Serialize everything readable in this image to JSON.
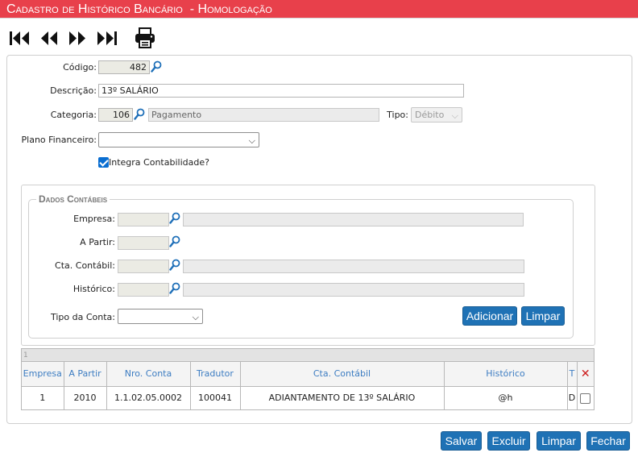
{
  "title": "Cadastro de Histórico Bancário  - Homologação",
  "toolbar": {
    "icons": [
      "first-record-icon",
      "previous-record-icon",
      "next-record-icon",
      "last-record-icon",
      "print-icon"
    ]
  },
  "form": {
    "codigo_label": "Código:",
    "codigo_value": "482",
    "descricao_label": "Descrição:",
    "descricao_value": "13º SALÁRIO",
    "categoria_label": "Categoria:",
    "categoria_code": "106",
    "categoria_name": "Pagamento",
    "tipo_label": "Tipo:",
    "tipo_value": "Débito",
    "plano_label": "Plano Financeiro:",
    "plano_value": "",
    "integra_label": "Integra Contabilidade?",
    "integra_checked": true
  },
  "dados": {
    "legend": "Dados Contábeis",
    "empresa_label": "Empresa:",
    "empresa_value": "",
    "empresa_desc": "",
    "apartir_label": "A Partir:",
    "apartir_value": "",
    "cta_label": "Cta. Contábil:",
    "cta_value": "",
    "cta_desc": "",
    "historico_label": "Histórico:",
    "historico_value": "",
    "historico_desc": "",
    "tipo_conta_label": "Tipo da Conta:",
    "tipo_conta_value": "",
    "adicionar_label": "Adicionar",
    "limpar_label": "Limpar"
  },
  "grid": {
    "pager_text": "1",
    "headers": [
      "Empresa",
      "A Partir",
      "Nro. Conta",
      "Tradutor",
      "Cta. Contábil",
      "Histórico",
      "T"
    ],
    "rows": [
      [
        "1",
        "2010",
        "1.1.02.05.0002",
        "100041",
        "ADIANTAMENTO DE 13º SALÁRIO",
        "@h",
        "D"
      ]
    ]
  },
  "footer": {
    "salvar": "Salvar",
    "excluir": "Excluir",
    "limpar": "Limpar",
    "fechar": "Fechar"
  },
  "colors": {
    "title_bar": "#e8404b",
    "button": "#1f72b5",
    "header_text": "#3d7dc2",
    "delete_icon": "#cc1a1a"
  }
}
